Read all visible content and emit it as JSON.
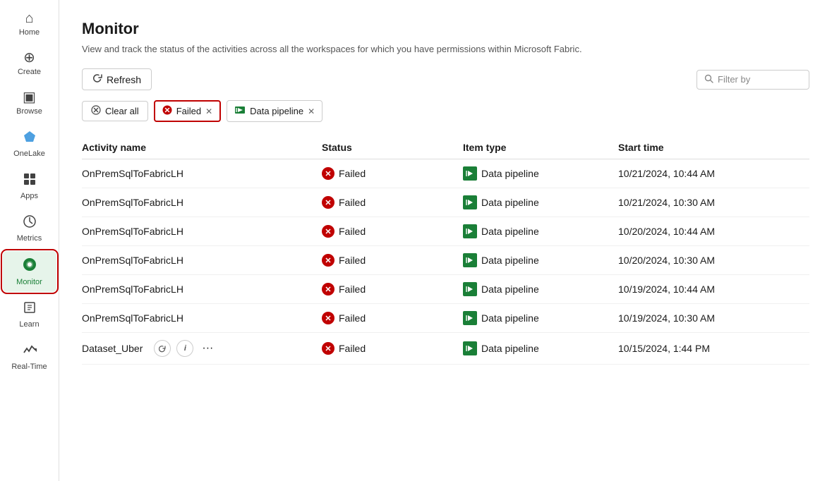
{
  "sidebar": {
    "items": [
      {
        "id": "home",
        "label": "Home",
        "icon": "⌂"
      },
      {
        "id": "create",
        "label": "Create",
        "icon": "⊕"
      },
      {
        "id": "browse",
        "label": "Browse",
        "icon": "▣"
      },
      {
        "id": "onelake",
        "label": "OneLake",
        "icon": "◈"
      },
      {
        "id": "apps",
        "label": "Apps",
        "icon": "⊞"
      },
      {
        "id": "metrics",
        "label": "Metrics",
        "icon": "⚖"
      },
      {
        "id": "monitor",
        "label": "Monitor",
        "icon": "●",
        "active": true
      },
      {
        "id": "learn",
        "label": "Learn",
        "icon": "📖"
      },
      {
        "id": "realtime",
        "label": "Real-Time",
        "icon": "⚡"
      }
    ]
  },
  "header": {
    "title": "Monitor",
    "subtitle": "View and track the status of the activities across all the workspaces for which you have permissions within Microsoft Fabric."
  },
  "toolbar": {
    "refresh_label": "Refresh",
    "filter_placeholder": "Filter by"
  },
  "filters": {
    "clear_all_label": "Clear all",
    "chips": [
      {
        "id": "failed",
        "label": "Failed",
        "active": true
      },
      {
        "id": "data-pipeline",
        "label": "Data pipeline",
        "active": false
      }
    ]
  },
  "table": {
    "columns": [
      "Activity name",
      "Status",
      "Item type",
      "Start time"
    ],
    "rows": [
      {
        "name": "OnPremSqlToFabricLH",
        "status": "Failed",
        "item_type": "Data pipeline",
        "start_time": "10/21/2024, 10:44 AM",
        "has_actions": false
      },
      {
        "name": "OnPremSqlToFabricLH",
        "status": "Failed",
        "item_type": "Data pipeline",
        "start_time": "10/21/2024, 10:30 AM",
        "has_actions": false
      },
      {
        "name": "OnPremSqlToFabricLH",
        "status": "Failed",
        "item_type": "Data pipeline",
        "start_time": "10/20/2024, 10:44 AM",
        "has_actions": false
      },
      {
        "name": "OnPremSqlToFabricLH",
        "status": "Failed",
        "item_type": "Data pipeline",
        "start_time": "10/20/2024, 10:30 AM",
        "has_actions": false
      },
      {
        "name": "OnPremSqlToFabricLH",
        "status": "Failed",
        "item_type": "Data pipeline",
        "start_time": "10/19/2024, 10:44 AM",
        "has_actions": false
      },
      {
        "name": "OnPremSqlToFabricLH",
        "status": "Failed",
        "item_type": "Data pipeline",
        "start_time": "10/19/2024, 10:30 AM",
        "has_actions": false
      },
      {
        "name": "Dataset_Uber",
        "status": "Failed",
        "item_type": "Data pipeline",
        "start_time": "10/15/2024, 1:44 PM",
        "has_actions": true
      }
    ]
  },
  "colors": {
    "failed_red": "#c00000",
    "active_green": "#1a7f37",
    "monitor_active_bg": "#e6f4ea",
    "link_blue": "#0066cc"
  }
}
